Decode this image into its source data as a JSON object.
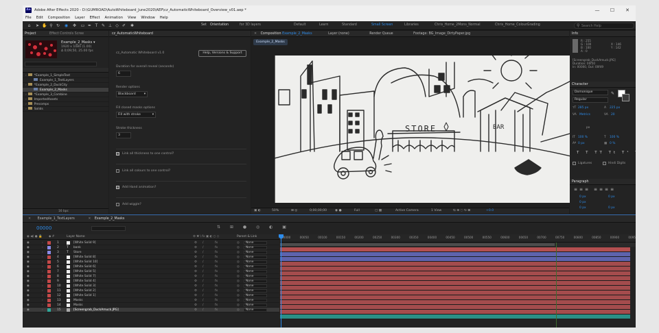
{
  "window": {
    "title": "Adobe After Effects 2020 - D:\\GUMROAD\\AutoWhiteboard_June2020\\AEP\\cz_AutomaticWhiteboard_Overview_v01.aep *",
    "logo": "Ae",
    "controls": [
      "—",
      "☐",
      "✕"
    ]
  },
  "menu": [
    "File",
    "Edit",
    "Composition",
    "Layer",
    "Effect",
    "Animation",
    "View",
    "Window",
    "Help"
  ],
  "toolbar": {
    "snapping_label": "Set",
    "orientation_value": "Orientation",
    "for3d": "for 3D layers",
    "workspaces": [
      {
        "label": "Default",
        "active": false
      },
      {
        "label": "Learn",
        "active": false
      },
      {
        "label": "Standard",
        "active": false
      },
      {
        "label": "Small Screen",
        "active": true
      },
      {
        "label": "Libraries",
        "active": false
      },
      {
        "label": "Chris_Home_2Mons_Normal",
        "active": false
      },
      {
        "label": "Chris_Home_ColourGrading",
        "active": false
      }
    ],
    "search_placeholder": "Search Help"
  },
  "project": {
    "tab": "Project",
    "tab2": "Effect Controls Scree",
    "comp_name": "Example_2_Masks ▾",
    "comp_info1": "1920 x 1080 (1.00)",
    "comp_info2": "Δ 0;09;50, 25.00 fps",
    "tree": [
      {
        "name": "*Example_1_SimpleText",
        "indent": 0,
        "selected": false,
        "folder": true
      },
      {
        "name": "Example_1_TextLayers",
        "indent": 1,
        "selected": false,
        "folder": false
      },
      {
        "name": "*Example_2_DuckCity",
        "indent": 0,
        "selected": false,
        "folder": true
      },
      {
        "name": "Example_2_Masks",
        "indent": 1,
        "selected": true,
        "folder": false
      },
      {
        "name": "*Example_3_Combine",
        "indent": 0,
        "selected": false,
        "folder": true
      },
      {
        "name": "ImportedAssets",
        "indent": 0,
        "selected": false,
        "folder": true
      },
      {
        "name": "Precomps",
        "indent": 0,
        "selected": false,
        "folder": true
      },
      {
        "name": "Solids",
        "indent": 0,
        "selected": false,
        "folder": true
      }
    ],
    "bpc": "16 bpc"
  },
  "script": {
    "tab": "cz_AutomaticWhiteboard",
    "version": "cz_Automatic Whiteboard v1.0",
    "help_button": "Help, Versions & Support",
    "duration_label": "Duration for overall reveal (seconds)",
    "duration_value": "6",
    "render_label": "Render options",
    "render_value": "Blackboard",
    "fill_label": "Fill closed masks options",
    "fill_value": "Fill with stroke",
    "stroke_label": "Stroke thickness",
    "stroke_value": "3",
    "link_thickness": "Link all thickness to one control?",
    "link_colours": "Link all colours to one control?",
    "add_hand": "Add Hand animation?",
    "add_wiggle": "Add wiggle?",
    "checks": [
      true,
      false,
      true,
      false
    ]
  },
  "viewer": {
    "tab": "Composition",
    "tab_comp": "Example_2_Masks",
    "tab_layer": "Layer (none)",
    "tab_render": "Render Queue",
    "tab_footage": "Footage: BG_Image_DirtyPaper.jpg",
    "crumb": "Example_2_Masks",
    "store_text": "STORE",
    "bar_text": "BAR",
    "zoom": "50%",
    "timecode": "0;00;00;00",
    "quality": "Full",
    "camera": "Active Camera",
    "views": "1 View",
    "exposure": "+0.0"
  },
  "info": {
    "tab": "Info",
    "r": "R : 255",
    "g": "G : 100",
    "b": "B : 100",
    "a": "A : 0",
    "x": "X : 146",
    "y": "Y : 142",
    "source": "[Screengrab_DuckAmuck.JPG]",
    "duration": "Duration: 00f50",
    "inout": "In: 00000, Out: 00f49"
  },
  "character": {
    "tab": "Character",
    "font": "Domonique",
    "style": "Regular",
    "size": "285 px",
    "leading": "225 px",
    "kern": "Metrics",
    "tracking": "20",
    "px": "px",
    "vscale": "100 %",
    "hscale": "100 %",
    "baseline": "0 px",
    "tsume": "0 %",
    "ligatures": "Ligatures",
    "hindi": "Hindi Digits"
  },
  "paragraph": {
    "tab": "Paragraph",
    "indent1": "0 px",
    "indent2": "0 px",
    "indent3": "0 px",
    "space1": "0 px",
    "space2": "0 px"
  },
  "timeline": {
    "tab1": "Example_1_TextLayers",
    "tab2": "Example_2_Masks",
    "timecode": "00000",
    "layer_header": "Layer Name",
    "parent_header": "Parent & Link",
    "ruler": [
      "00000",
      "00050",
      "00100",
      "00150",
      "00200",
      "00250",
      "00300",
      "00350",
      "00400",
      "00450",
      "00500",
      "00550",
      "00600",
      "00650",
      "00700",
      "00750",
      "00800",
      "00850",
      "00900",
      "00950"
    ],
    "layers": [
      {
        "num": "1",
        "type": "solid",
        "color": "#c44848",
        "name": "[White Solid 9]",
        "parent": "None",
        "bar": "#b34f50"
      },
      {
        "num": "2",
        "type": "text",
        "color": "#8a8ae6",
        "name": "bank",
        "parent": "None",
        "bar": "#5e63ad"
      },
      {
        "num": "3",
        "type": "text",
        "color": "#8a8ae6",
        "name": "Store",
        "parent": "None",
        "bar": "#5e63ad"
      },
      {
        "num": "4",
        "type": "solid",
        "color": "#c44848",
        "name": "[White Solid 8]",
        "parent": "None",
        "bar": "#a44c4d"
      },
      {
        "num": "5",
        "type": "solid",
        "color": "#c44848",
        "name": "[White Solid 10]",
        "parent": "None",
        "bar": "#a44c4d"
      },
      {
        "num": "6",
        "type": "solid",
        "color": "#c44848",
        "name": "[White Solid 6]",
        "parent": "None",
        "bar": "#a44c4d"
      },
      {
        "num": "7",
        "type": "solid",
        "color": "#c44848",
        "name": "[White Solid 5]",
        "parent": "None",
        "bar": "#a44c4d"
      },
      {
        "num": "8",
        "type": "solid",
        "color": "#c44848",
        "name": "[White Solid 7]",
        "parent": "None",
        "bar": "#a44c4d"
      },
      {
        "num": "9",
        "type": "solid",
        "color": "#c44848",
        "name": "[White Solid 4]",
        "parent": "None",
        "bar": "#a44c4d"
      },
      {
        "num": "10",
        "type": "solid",
        "color": "#c44848",
        "name": "[White Solid 3]",
        "parent": "None",
        "bar": "#a44c4d"
      },
      {
        "num": "11",
        "type": "solid",
        "color": "#c44848",
        "name": "[White Solid 2]",
        "parent": "None",
        "bar": "#a44c4d"
      },
      {
        "num": "12",
        "type": "solid",
        "color": "#c44848",
        "name": "[White Solid 1]",
        "parent": "None",
        "bar": "#a44c4d"
      },
      {
        "num": "13",
        "type": "solid",
        "color": "#c44848",
        "name": "Masks",
        "parent": "None",
        "bar": "#a44c4d"
      },
      {
        "num": "14",
        "type": "solid",
        "color": "#c44848",
        "name": "Masks",
        "parent": "None",
        "bar": "#a44c4d"
      },
      {
        "num": "15",
        "type": "image",
        "color": "#2fa89a",
        "name": "[Screengrab_DuckAmuck.JPG]",
        "parent": "None",
        "bar": "#2a8f86"
      }
    ]
  }
}
